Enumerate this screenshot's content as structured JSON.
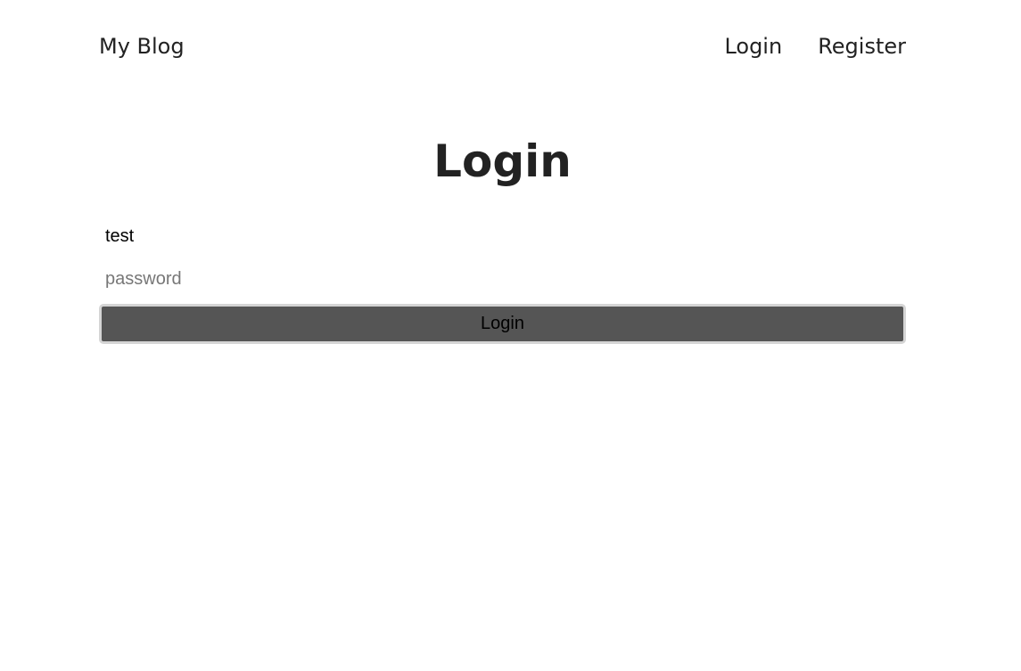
{
  "header": {
    "brand": "My Blog",
    "nav": {
      "login": "Login",
      "register": "Register"
    }
  },
  "main": {
    "title": "Login",
    "username_value": "test",
    "password_placeholder": "password",
    "submit_label": "Login"
  },
  "colors": {
    "text": "#222222",
    "button_background": "#555555",
    "button_border": "#d5d5d5"
  }
}
